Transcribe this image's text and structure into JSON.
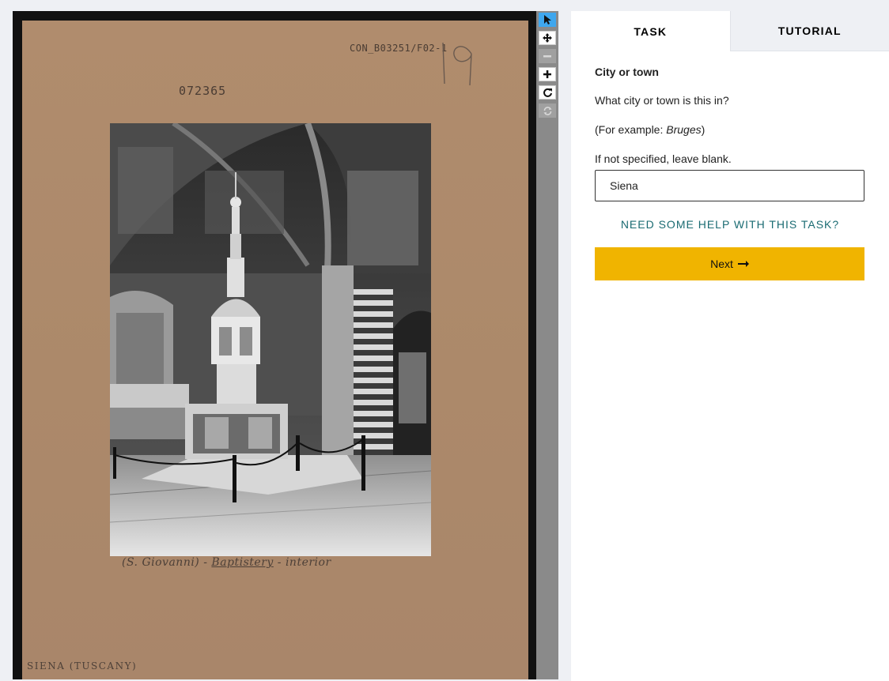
{
  "viewer": {
    "card": {
      "stamp_top": "CON_B03251/F02-1",
      "stamp_number": "072365",
      "pencil_number": "19",
      "caption_part1": "(S. Giovanni) - ",
      "caption_part2": "Baptistery",
      "caption_part3": " - interior",
      "city_label": "SIENA (TUSCANY)"
    },
    "photo": {
      "description_icon": "photo-baptistery-interior"
    }
  },
  "toolbar": {
    "tools": [
      {
        "name": "annotate-tool",
        "icon": "cursor-arrow-icon",
        "active": true
      },
      {
        "name": "pan-tool",
        "icon": "move-arrows-icon",
        "active": false
      },
      {
        "name": "zoom-out-tool",
        "icon": "minus-icon",
        "disabled": true
      },
      {
        "name": "zoom-in-tool",
        "icon": "plus-icon",
        "active": false
      },
      {
        "name": "rotate-tool",
        "icon": "rotate-icon",
        "active": false
      },
      {
        "name": "reset-tool",
        "icon": "refresh-icon",
        "disabled": true
      }
    ]
  },
  "panel": {
    "tabs": [
      {
        "label": "TASK",
        "active": true
      },
      {
        "label": "TUTORIAL",
        "active": false
      }
    ],
    "task": {
      "title": "City or town",
      "question": "What city or town is this in?",
      "example_prefix": "(For example: ",
      "example_value": "Bruges",
      "example_suffix": ")",
      "instruction": "If not specified, leave blank.",
      "answer_value": "Siena",
      "help_link": "NEED SOME HELP WITH THIS TASK?",
      "next_label": "Next",
      "next_icon": "arrow-right-icon"
    }
  },
  "colors": {
    "accent_button": "#f0b400",
    "help_link": "#1a6b72",
    "active_tool": "#3fa7ee",
    "card": "#ae8b6c"
  }
}
